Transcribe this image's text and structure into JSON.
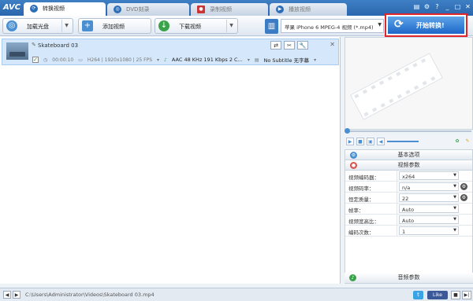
{
  "app": {
    "logo": "AVC"
  },
  "tabs": [
    {
      "label": "转换视频",
      "active": true
    },
    {
      "label": "DVD刻录",
      "active": false
    },
    {
      "label": "录制视频",
      "active": false
    },
    {
      "label": "播放视频",
      "active": false
    }
  ],
  "window_controls": [
    "▤",
    "⚙",
    "?",
    "_",
    "□",
    "✕"
  ],
  "toolbar": {
    "load_disc": "加载光盘",
    "add_video": "添加视频",
    "download_video": "下载视频",
    "profile": "苹果 iPhone 6 MPEG-4 视频 (*.mp4)",
    "convert": "开始转换!"
  },
  "item": {
    "filename": "Skateboard 03",
    "duration": "00:00:10",
    "video_info": "H264 | 1920x1080 | 25 FPS",
    "audio": "AAC 48 KHz 191 Kbps 2 C...",
    "subtitle": "No Subtitle 无字幕"
  },
  "settings": {
    "basic_section": "基本选项",
    "video_section": "视频参数",
    "audio_section": "音频参数",
    "params": [
      {
        "label": "视频编码器：",
        "value": "x264"
      },
      {
        "label": "视频码率：",
        "value": "n/a"
      },
      {
        "label": "恒定质量：",
        "value": "22"
      },
      {
        "label": "帧率：",
        "value": "Auto"
      },
      {
        "label": "视频宽高比：",
        "value": "Auto"
      },
      {
        "label": "编码次数：",
        "value": "1"
      }
    ]
  },
  "status": {
    "path": "C:\\Users\\Administrator\\Videos\\Skateboard 03.mp4",
    "like": "Like"
  },
  "colors": {
    "accent": "#2b66ad",
    "convert_border": "#e0262b",
    "selected_row": "#d5e8fb"
  }
}
